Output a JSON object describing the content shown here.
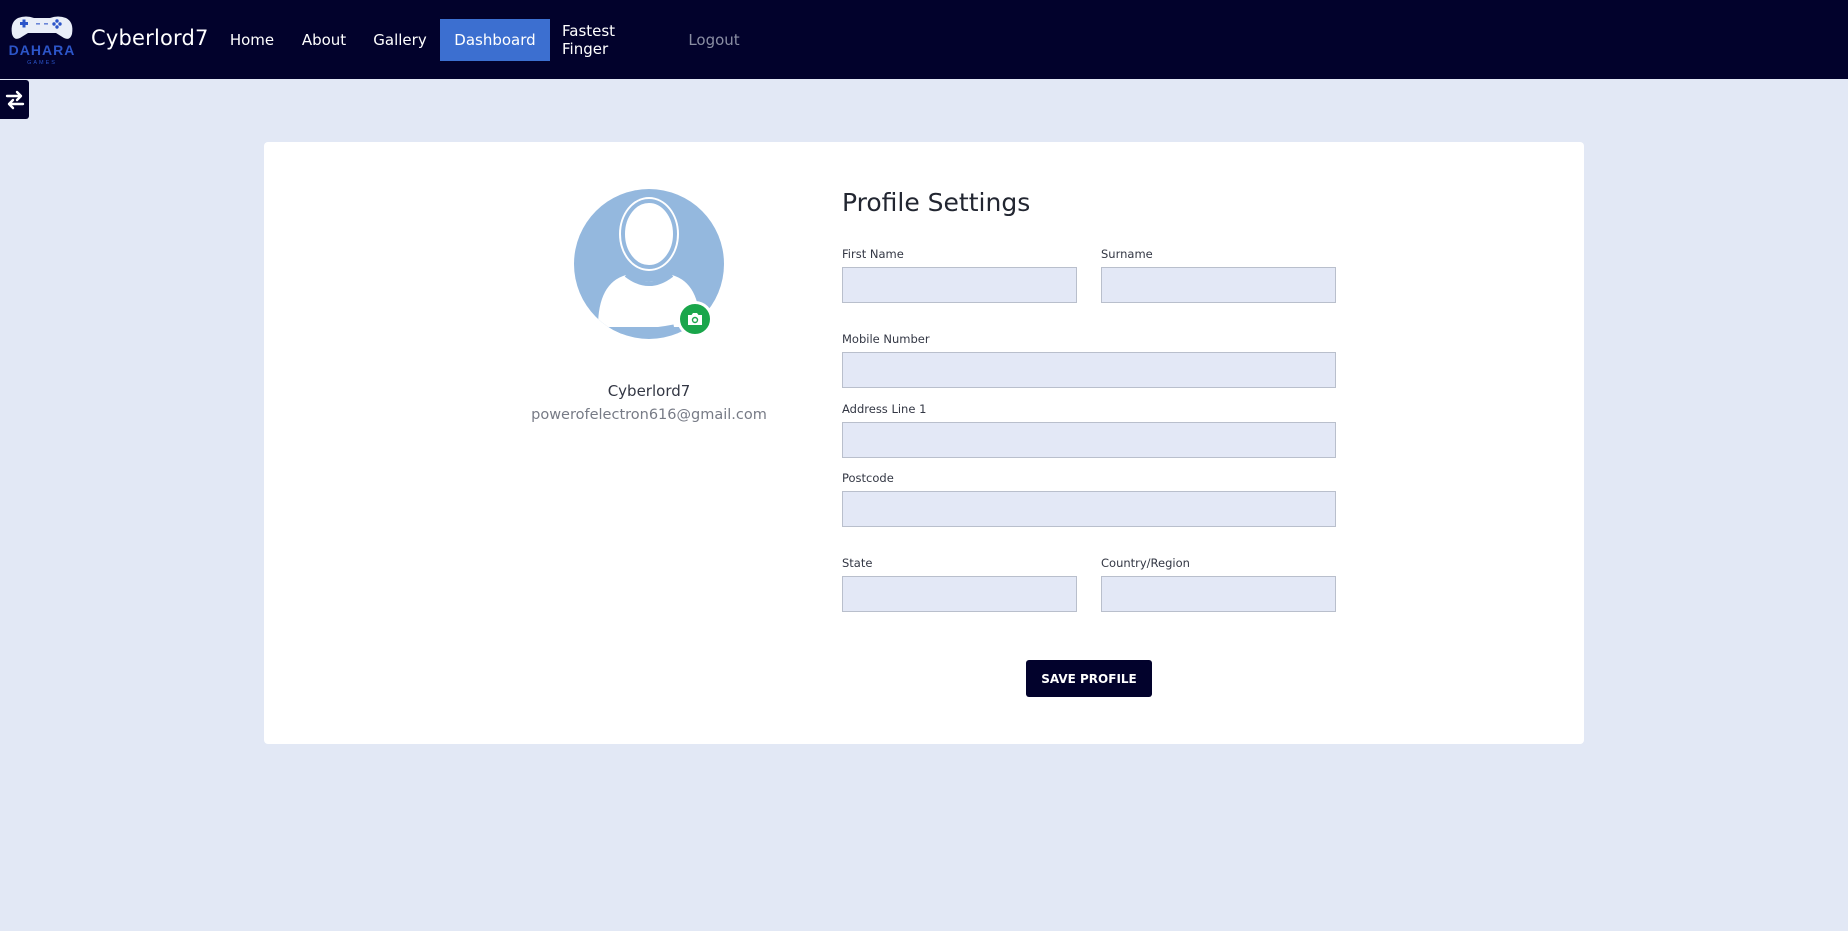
{
  "navbar": {
    "logo_text": "DAHARA",
    "logo_sub": "GAMES",
    "brand": "Cyberlord7",
    "items": [
      {
        "label": "Home"
      },
      {
        "label": "About"
      },
      {
        "label": "Gallery"
      },
      {
        "label": "Dashboard",
        "active": true
      },
      {
        "label": "Fastest Finger"
      },
      {
        "label": "Logout"
      }
    ]
  },
  "sidebar_toggle": {
    "icon": "swap-arrows-icon"
  },
  "profile": {
    "username": "Cyberlord7",
    "email": "powerofelectron616@gmail.com",
    "avatar_icon": "user-silhouette-icon",
    "camera_icon": "camera-icon"
  },
  "form": {
    "title": "Profile Settings",
    "first_name": {
      "label": "First Name",
      "value": ""
    },
    "surname": {
      "label": "Surname",
      "value": ""
    },
    "mobile": {
      "label": "Mobile Number",
      "value": ""
    },
    "address1": {
      "label": "Address Line 1",
      "value": ""
    },
    "postcode": {
      "label": "Postcode",
      "value": ""
    },
    "state": {
      "label": "State",
      "value": ""
    },
    "country": {
      "label": "Country/Region",
      "value": ""
    },
    "save_label": "SAVE PROFILE"
  },
  "colors": {
    "navbar": "#02022c",
    "active_tab": "#3c6fd0",
    "page_bg": "#e2e8f5",
    "camera_badge": "#1aa64b",
    "avatar": "#94b8de"
  }
}
